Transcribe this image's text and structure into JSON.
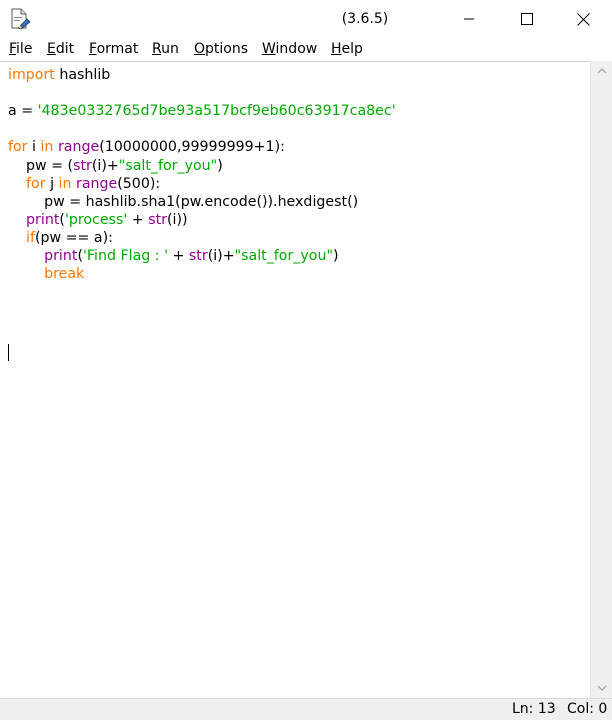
{
  "window": {
    "title": "(3.6.5)",
    "icon": "idle-file-icon",
    "controls": [
      "minimize-icon",
      "maximize-icon",
      "close-icon"
    ]
  },
  "menu": [
    "File",
    "Edit",
    "Format",
    "Run",
    "Options",
    "Window",
    "Help"
  ],
  "editor": {
    "lines": [
      [
        [
          "kw",
          "import"
        ],
        [
          "p",
          " hashlib"
        ]
      ],
      [],
      [
        [
          "p",
          "a = "
        ],
        [
          "st",
          "'483e0332765d7be93a517bcf9eb60c63917ca8ec'"
        ]
      ],
      [],
      [
        [
          "kw",
          "for"
        ],
        [
          "p",
          " i "
        ],
        [
          "kw",
          "in"
        ],
        [
          "p",
          " "
        ],
        [
          "bi",
          "range"
        ],
        [
          "p",
          "(10000000,99999999+1):"
        ]
      ],
      [
        [
          "p",
          "    pw = ("
        ],
        [
          "bi",
          "str"
        ],
        [
          "p",
          "(i)+"
        ],
        [
          "st",
          "\"salt_for_you\""
        ],
        [
          "p",
          ")"
        ]
      ],
      [
        [
          "p",
          "    "
        ],
        [
          "kw",
          "for"
        ],
        [
          "p",
          " j "
        ],
        [
          "kw",
          "in"
        ],
        [
          "p",
          " "
        ],
        [
          "bi",
          "range"
        ],
        [
          "p",
          "(500):"
        ]
      ],
      [
        [
          "p",
          "        pw = hashlib.sha1(pw.encode()).hexdigest()"
        ]
      ],
      [
        [
          "p",
          "    "
        ],
        [
          "bi",
          "print"
        ],
        [
          "p",
          "("
        ],
        [
          "st",
          "'process'"
        ],
        [
          "p",
          " + "
        ],
        [
          "bi",
          "str"
        ],
        [
          "p",
          "(i))"
        ]
      ],
      [
        [
          "p",
          "    "
        ],
        [
          "kw",
          "if"
        ],
        [
          "p",
          "(pw == a):"
        ]
      ],
      [
        [
          "p",
          "        "
        ],
        [
          "bi",
          "print"
        ],
        [
          "p",
          "("
        ],
        [
          "st",
          "'Find Flag : '"
        ],
        [
          "p",
          " + "
        ],
        [
          "bi",
          "str"
        ],
        [
          "p",
          "(i)+"
        ],
        [
          "st",
          "\"salt_for_you\""
        ],
        [
          "p",
          ")"
        ]
      ],
      [
        [
          "p",
          "        "
        ],
        [
          "kw",
          "break"
        ]
      ],
      []
    ],
    "colors": {
      "keyword": "#ff7700",
      "builtin": "#900090",
      "string": "#00aa00",
      "plain": "#000000"
    }
  },
  "status": {
    "line": "Ln: 13",
    "col": "Col: 0"
  }
}
